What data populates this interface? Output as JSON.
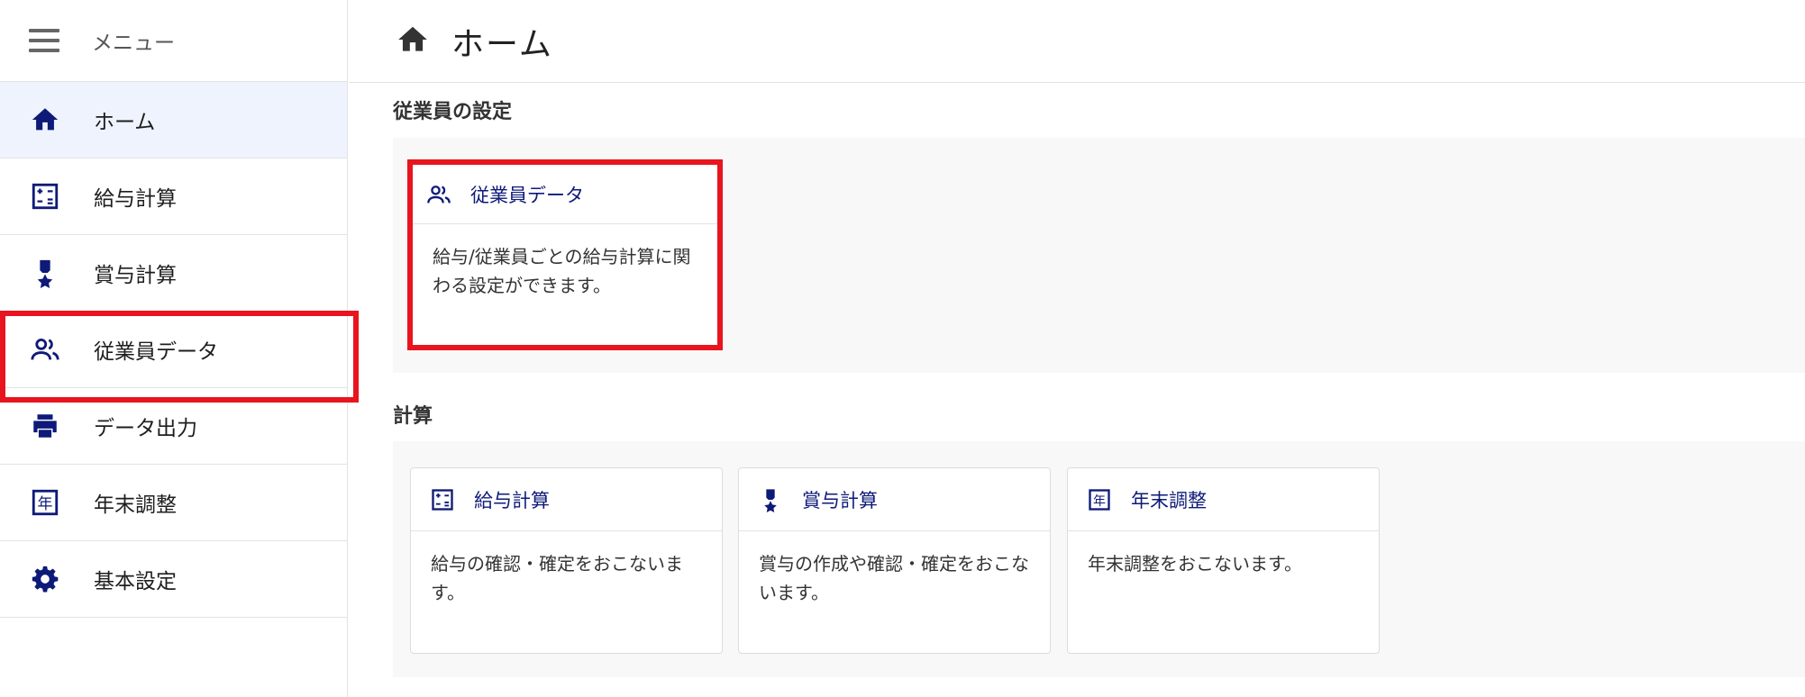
{
  "sidebar": {
    "menu_label": "メニュー",
    "items": [
      {
        "label": "ホーム",
        "icon": "home-icon"
      },
      {
        "label": "給与計算",
        "icon": "calculator-icon"
      },
      {
        "label": "賞与計算",
        "icon": "medal-icon"
      },
      {
        "label": "従業員データ",
        "icon": "people-icon"
      },
      {
        "label": "データ出力",
        "icon": "printer-icon"
      },
      {
        "label": "年末調整",
        "icon": "year-icon"
      },
      {
        "label": "基本設定",
        "icon": "gear-icon"
      }
    ]
  },
  "header": {
    "title": "ホーム",
    "icon": "home-icon"
  },
  "sections": {
    "employee": {
      "title": "従業員の設定",
      "cards": [
        {
          "title": "従業員データ",
          "description": "給与/従業員ごとの給与計算に関わる設定ができます。",
          "icon": "people-icon"
        }
      ]
    },
    "calc": {
      "title": "計算",
      "cards": [
        {
          "title": "給与計算",
          "description": "給与の確認・確定をおこないます。",
          "icon": "calculator-icon"
        },
        {
          "title": "賞与計算",
          "description": "賞与の作成や確認・確定をおこないます。",
          "icon": "medal-icon"
        },
        {
          "title": "年末調整",
          "description": "年末調整をおこないます。",
          "icon": "year-icon"
        }
      ]
    }
  },
  "colors": {
    "icon": "#0e1a78",
    "highlight": "#e8141e",
    "active_bg": "#eef3fd",
    "section_bg": "#f8f8f8"
  }
}
